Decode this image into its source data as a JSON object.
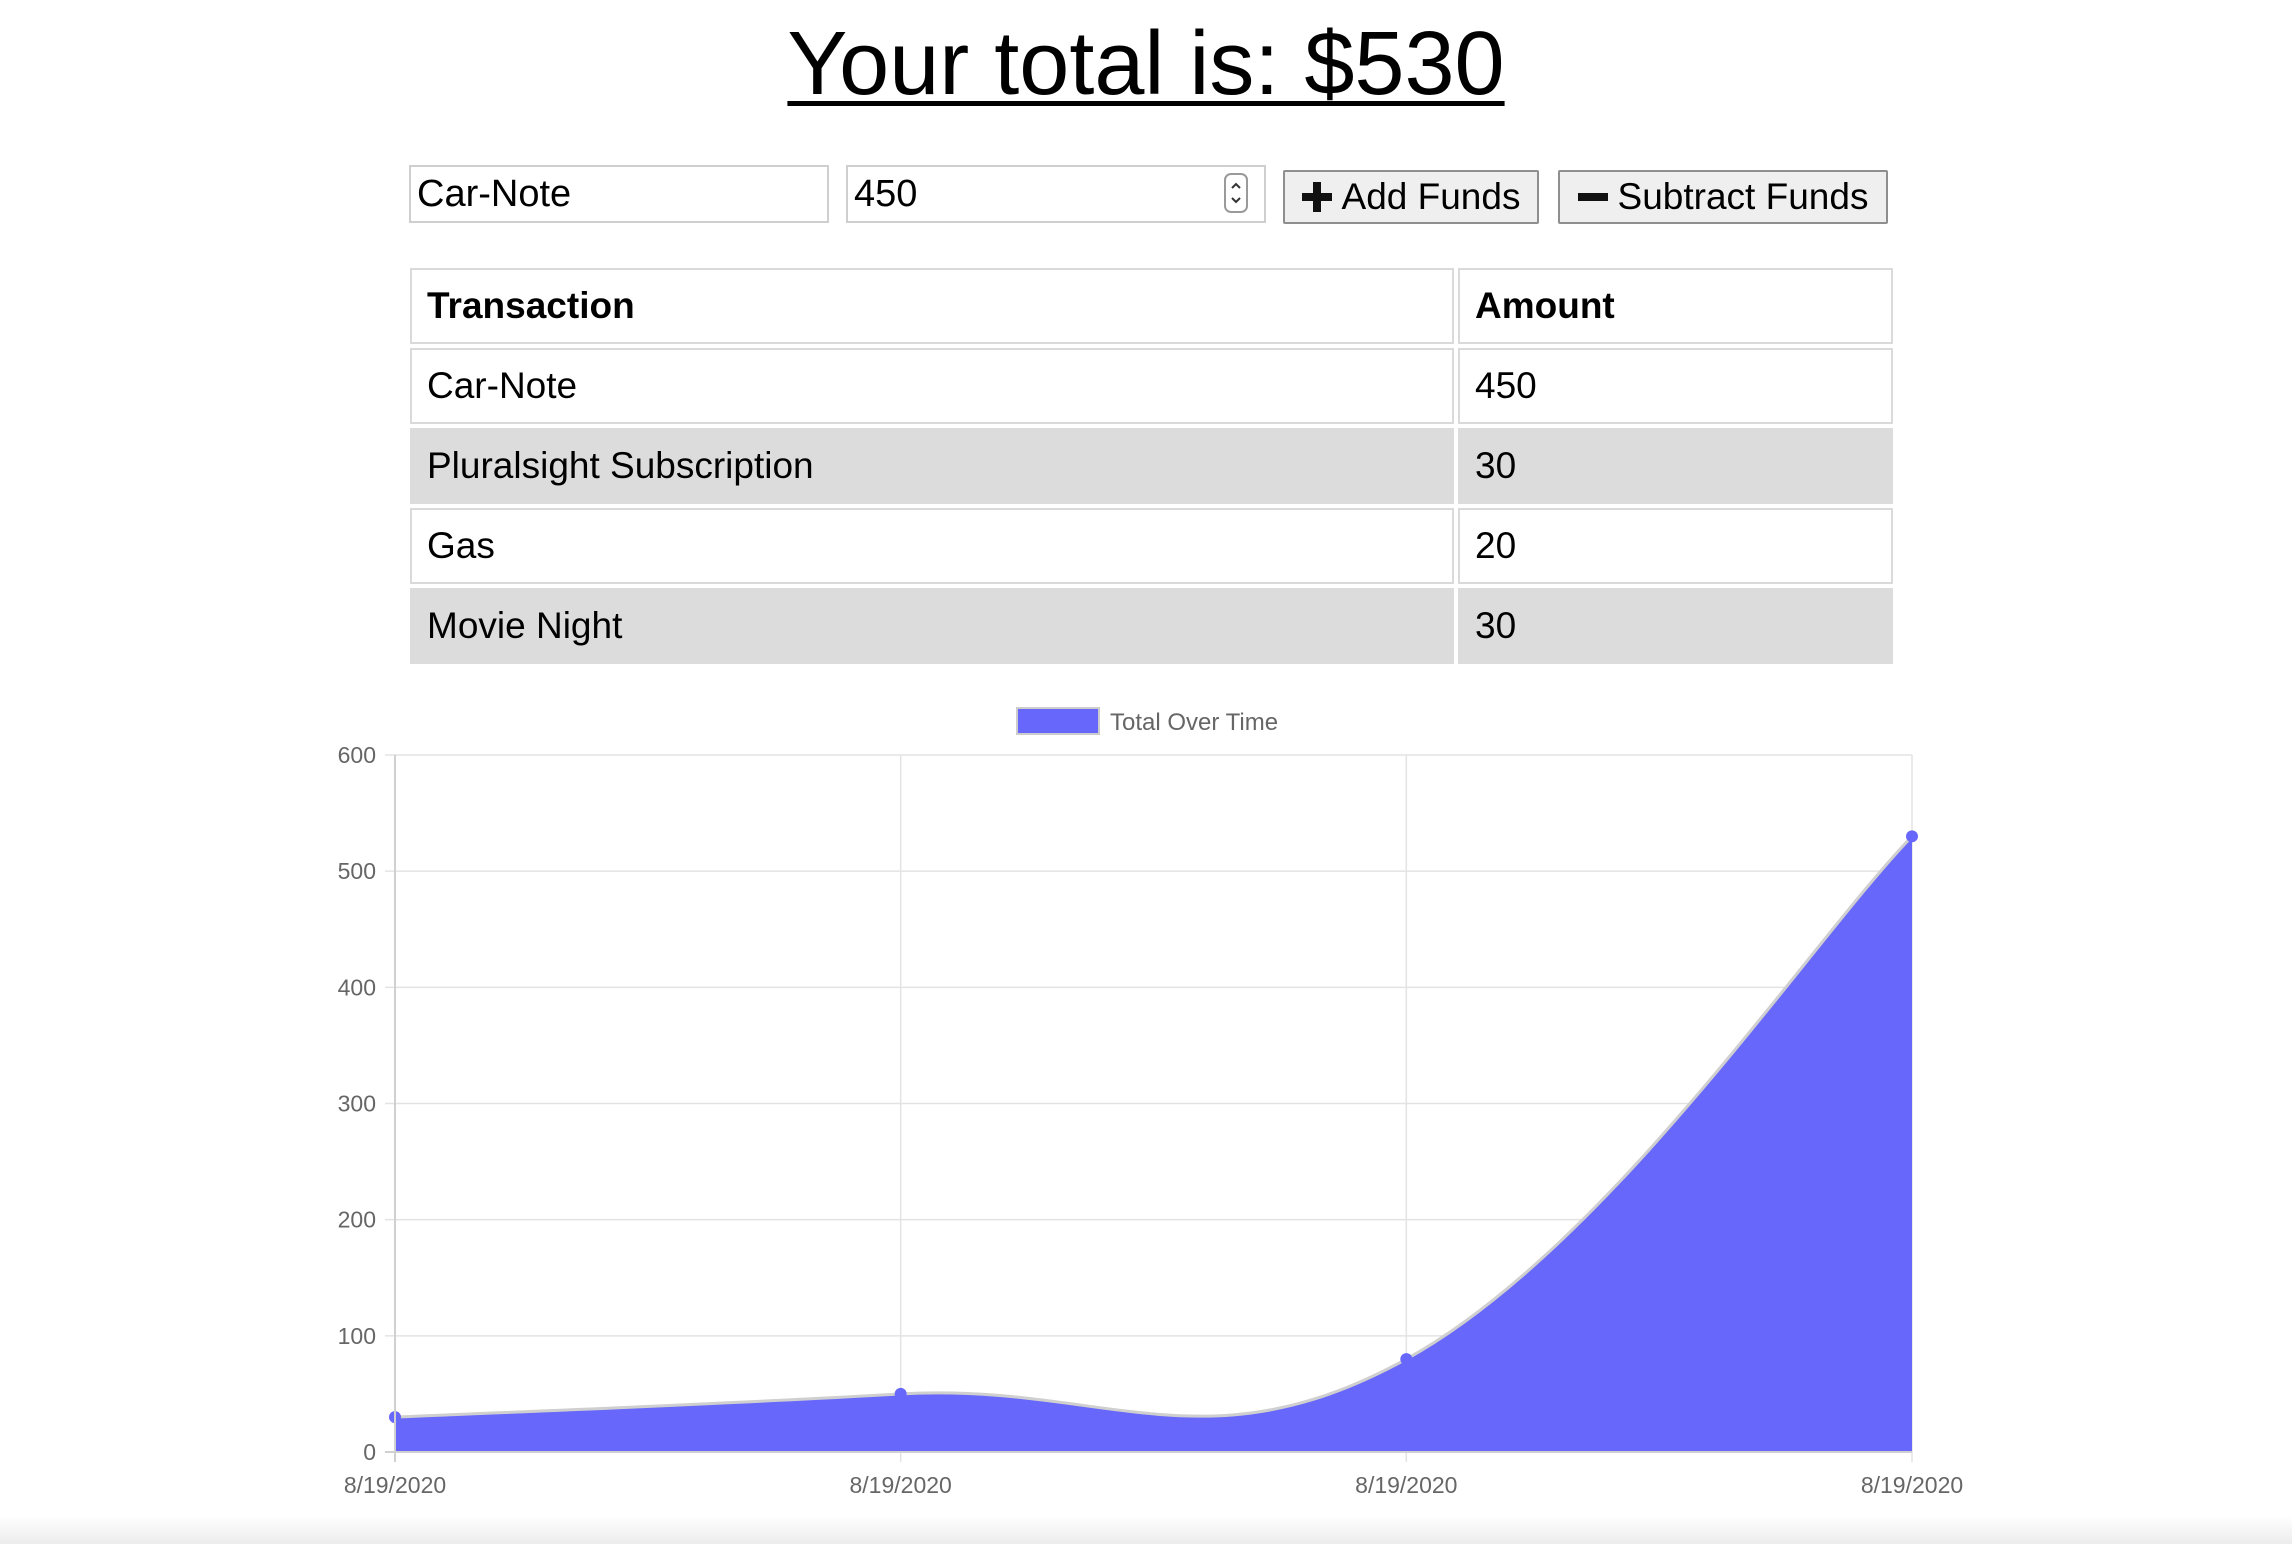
{
  "header": {
    "title": "Your total is: $530"
  },
  "form": {
    "name_value": "Car-Note",
    "amount_value": "450",
    "add_label": "Add Funds",
    "subtract_label": "Subtract Funds"
  },
  "table": {
    "headers": [
      "Transaction",
      "Amount"
    ],
    "rows": [
      {
        "name": "Car-Note",
        "amount": "450"
      },
      {
        "name": "Pluralsight Subscription",
        "amount": "30"
      },
      {
        "name": "Gas",
        "amount": "20"
      },
      {
        "name": "Movie Night",
        "amount": "30"
      }
    ]
  },
  "colors": {
    "series_fill": "#6767fb",
    "grid": "#e3e3e3",
    "tick_text": "#666666"
  },
  "chart_data": {
    "type": "area",
    "x": [
      "8/19/2020",
      "8/19/2020",
      "8/19/2020",
      "8/19/2020"
    ],
    "series": [
      {
        "name": "Total Over Time",
        "values": [
          30,
          50,
          80,
          530
        ]
      }
    ],
    "ylim": [
      0,
      600
    ],
    "y_ticks": [
      0,
      100,
      200,
      300,
      400,
      500,
      600
    ],
    "grid": true,
    "legend": "top-center"
  }
}
